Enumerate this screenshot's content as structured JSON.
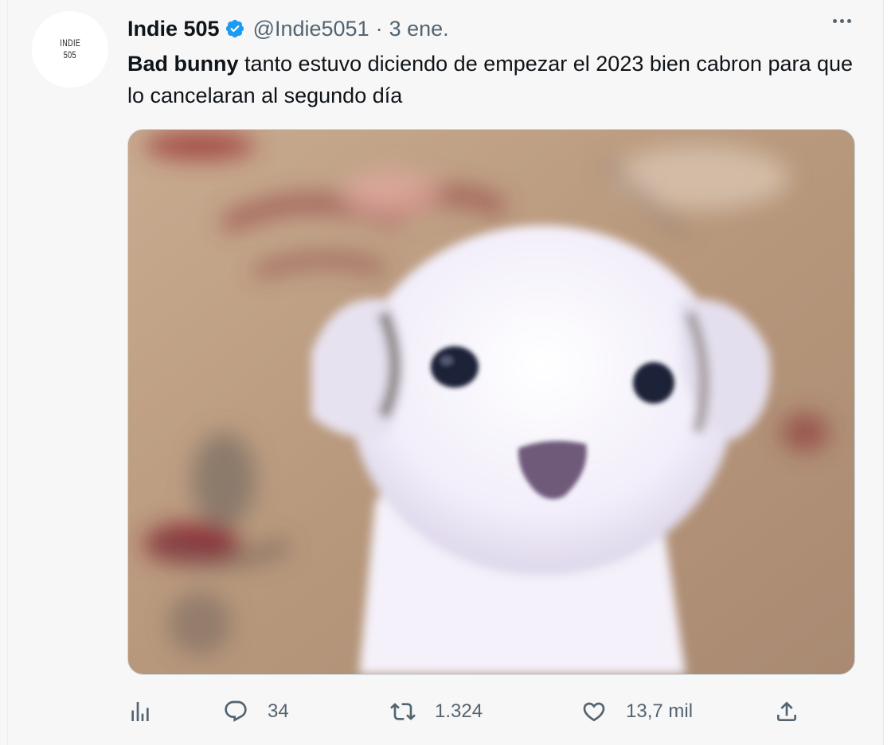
{
  "tweet": {
    "avatar": {
      "line1": "INDIE",
      "line2": "505"
    },
    "author_name": "Indie 505",
    "handle": "@Indie5051",
    "separator": "·",
    "date": "3 ene.",
    "text_bold": "Bad bunny",
    "text_rest": " tanto estuvo diciendo de empezar el 2023 bien cabron para que lo cancelaran al segundo día",
    "media_subject": "white-puppy-photo",
    "actions": {
      "analytics_icon": "bar-chart-icon",
      "reply_icon": "speech-bubble-icon",
      "reply_count": "34",
      "retweet_icon": "retweet-arrows-icon",
      "retweet_count": "1.324",
      "like_icon": "heart-icon",
      "like_count": "13,7 mil",
      "share_icon": "share-upload-icon"
    }
  },
  "colors": {
    "verified": "#1d9bf0",
    "secondary_text": "#536471",
    "primary_text": "#0f1419"
  }
}
